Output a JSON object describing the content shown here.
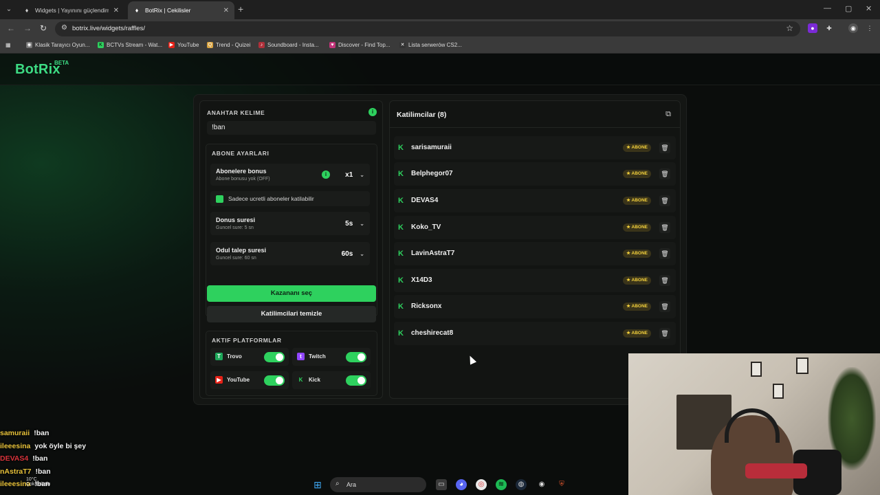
{
  "browser": {
    "tabs": [
      {
        "title": "Widgets | Yayınını güçlendirmek",
        "active": false
      },
      {
        "title": "BotRix | Cekilisler",
        "active": true
      }
    ],
    "url": "botrix.live/widgets/raffles/",
    "bookmarks": [
      {
        "label": "Klasik Tarayıcı Oyun...",
        "icon": "globe-icon"
      },
      {
        "label": "BCTVs Stream - Wat...",
        "icon": "kick-icon"
      },
      {
        "label": "YouTube",
        "icon": "youtube-icon"
      },
      {
        "label": "Trend - Quizei",
        "icon": "quiz-icon"
      },
      {
        "label": "Soundboard - Insta...",
        "icon": "soundboard-icon"
      },
      {
        "label": "Discover - Find Top...",
        "icon": "discover-icon"
      },
      {
        "label": "Lista serwerów CS2...",
        "icon": "cs-icon"
      }
    ]
  },
  "app": {
    "logo": "BotRix",
    "beta": "BETA"
  },
  "keyword": {
    "title": "ANAHTAR KELIME",
    "value": "!ban"
  },
  "subscriber": {
    "title": "ABONE AYARLARI",
    "bonus_title": "Abonelere bonus",
    "bonus_sub": "Abone bonusu yok (OFF)",
    "bonus_value": "x1",
    "only_paid_label": "Sadece ucretli aboneler katilabilir",
    "donus_title": "Donus suresi",
    "donus_sub": "Guncel sure: 5 sn",
    "donus_value": "5s",
    "odul_title": "Odul talep suresi",
    "odul_sub": "Guncel sure: 60 sn",
    "odul_value": "60s"
  },
  "actions": {
    "pick_winner": "Kazananı seç",
    "clear_participants": "Katilimcilari temizle"
  },
  "platforms": {
    "title": "AKTIF PLATFORMLAR",
    "items": [
      {
        "name": "Trovo",
        "enabled": true
      },
      {
        "name": "Twitch",
        "enabled": true
      },
      {
        "name": "YouTube",
        "enabled": true
      },
      {
        "name": "Kick",
        "enabled": true
      }
    ]
  },
  "participants": {
    "title": "Katilimcilar (8)",
    "badge": "ABONE",
    "list": [
      "sarisamuraii",
      "Belphegor07",
      "DEVAS4",
      "Koko_TV",
      "LavinAstraT7",
      "X14D3",
      "Ricksonx",
      "cheshirecat8"
    ]
  },
  "chat": [
    {
      "name": "samuraii",
      "msg": "!ban",
      "color": "#e8c23a"
    },
    {
      "name": "ileeesina",
      "msg": "yok öyle bi şey",
      "color": "#e8c23a"
    },
    {
      "name": "DEVAS4",
      "msg": "!ban",
      "color": "#d9333b"
    },
    {
      "name": "nAstraT7",
      "msg": "!ban",
      "color": "#e8c23a"
    },
    {
      "name": "ileeesina",
      "msg": "!ban",
      "color": "#e8c23a"
    }
  ],
  "taskbar": {
    "search_label": "Ara",
    "weather_temp": "10°C",
    "weather_desc": "Çok bulutlu"
  },
  "colors": {
    "accent": "#2ed15e",
    "badge_text": "#f5d23c"
  }
}
